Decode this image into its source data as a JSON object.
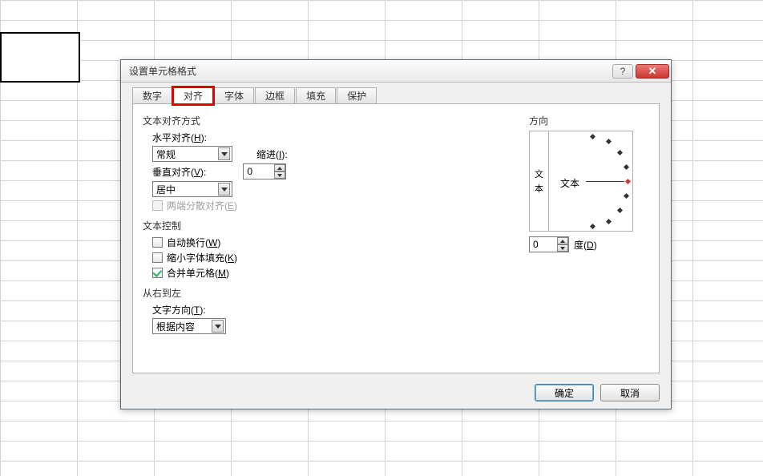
{
  "dialog": {
    "title": "设置单元格格式",
    "tabs": [
      "数字",
      "对齐",
      "字体",
      "边框",
      "填充",
      "保护"
    ],
    "active_tab": "对齐"
  },
  "alignment": {
    "group1": "文本对齐方式",
    "h_label": "水平对齐",
    "h_key": "H",
    "h_value": "常规",
    "indent_label": "缩进",
    "indent_key": "I",
    "indent_value": "0",
    "v_label": "垂直对齐",
    "v_key": "V",
    "v_value": "居中",
    "justify_dist_label": "两端分散对齐",
    "justify_dist_key": "E"
  },
  "text_control": {
    "group": "文本控制",
    "wrap_label": "自动换行",
    "wrap_key": "W",
    "shrink_label": "缩小字体填充",
    "shrink_key": "K",
    "merge_label": "合并单元格",
    "merge_key": "M"
  },
  "rtl": {
    "group": "从右到左",
    "dir_label": "文字方向",
    "dir_key": "T",
    "dir_value": "根据内容"
  },
  "orientation": {
    "group": "方向",
    "vertical_text": "文本",
    "arc_text": "文本",
    "deg_value": "0",
    "deg_label": "度",
    "deg_key": "D"
  },
  "buttons": {
    "ok": "确定",
    "cancel": "取消"
  }
}
